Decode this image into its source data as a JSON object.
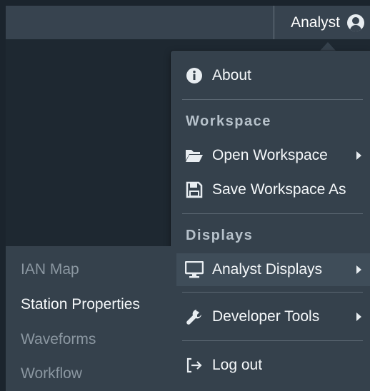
{
  "header": {
    "user_label": "Analyst",
    "user_icon": "user-circle-icon"
  },
  "menu": {
    "about": "About",
    "workspace_header": "Workspace",
    "open_workspace": "Open Workspace",
    "save_workspace_as": "Save Workspace As",
    "displays_header": "Displays",
    "analyst_displays": "Analyst Displays",
    "developer_tools": "Developer Tools",
    "log_out": "Log out"
  },
  "submenu": {
    "items": [
      "IAN Map",
      "Station Properties",
      "Waveforms",
      "Workflow"
    ],
    "selected": "Station Properties"
  },
  "colors": {
    "background": "#1b242d",
    "menu": "#35414c",
    "text": "#f5f8fa",
    "muted": "#8b97a1"
  }
}
